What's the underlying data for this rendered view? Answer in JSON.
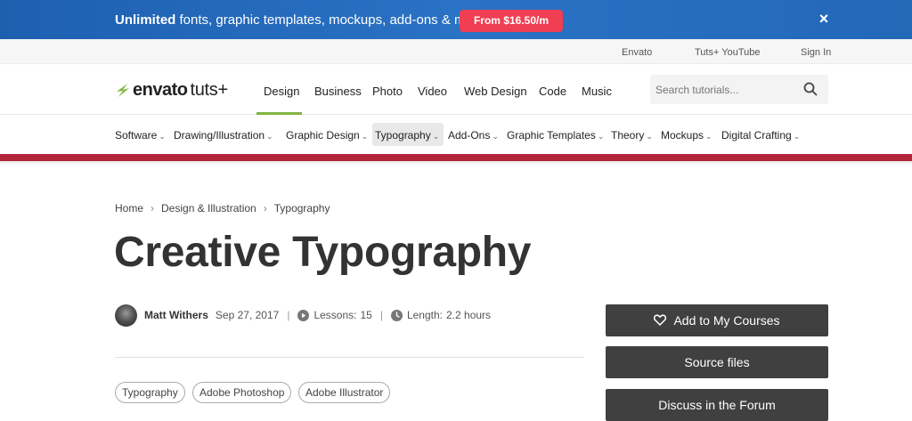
{
  "promo": {
    "bold": "Unlimited",
    "text": " fonts, graphic templates, mockups, add-ons & more!",
    "button": "From $16.50/m",
    "close": "×"
  },
  "topbar": {
    "links": [
      "Envato",
      "Tuts+ YouTube",
      "Sign In"
    ]
  },
  "logo": {
    "brand": "envato",
    "product": "tuts+"
  },
  "nav": {
    "items": [
      "Design",
      "Business",
      "Photo",
      "Video",
      "Web Design",
      "Code",
      "Music"
    ],
    "active": "Design"
  },
  "search": {
    "placeholder": "Search tutorials..."
  },
  "subnav": {
    "items": [
      "Software",
      "Drawing/Illustration",
      "Graphic Design",
      "Typography",
      "Add-Ons",
      "Graphic Templates",
      "Theory",
      "Mockups",
      "Digital Crafting"
    ],
    "active": "Typography"
  },
  "breadcrumb": [
    "Home",
    "Design & Illustration",
    "Typography"
  ],
  "page": {
    "title": "Creative Typography"
  },
  "meta": {
    "author": "Matt Withers",
    "date": "Sep 27, 2017",
    "lessons_label": "Lessons:",
    "lessons": "15",
    "length_label": "Length:",
    "length": "2.2 hours",
    "separator": "|"
  },
  "tags": [
    "Typography",
    "Adobe Photoshop",
    "Adobe Illustrator"
  ],
  "sidebar": {
    "buttons": [
      "Add to My Courses",
      "Source files",
      "Discuss in the Forum"
    ]
  },
  "colors": {
    "promo_bg": "#2468b8",
    "promo_button": "#f03e52",
    "accent_green": "#82b541",
    "category_bar": "#b3253a",
    "button_dark": "#404040"
  }
}
